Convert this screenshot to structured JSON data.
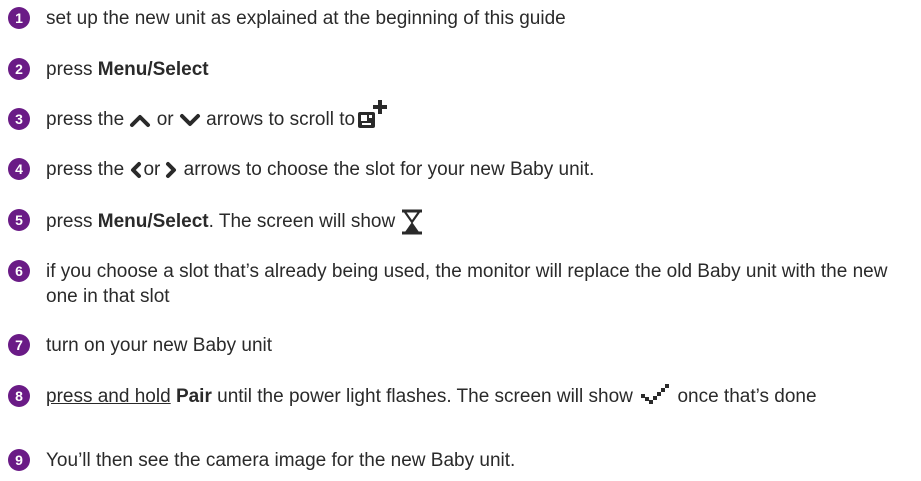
{
  "steps": [
    {
      "num": "1",
      "text": "set up the new unit as explained at the beginning of this guide"
    },
    {
      "num": "2",
      "pre": "press ",
      "bold": "Menu/Select"
    },
    {
      "num": "3",
      "pre": "press the ",
      "mid": " or ",
      "post": " arrows to scroll to",
      "icons": [
        "up-arrow-icon",
        "down-arrow-icon",
        "add-baby-unit-icon"
      ]
    },
    {
      "num": "4",
      "pre": "press the ",
      "mid": "or",
      "post": " arrows to choose the slot for your new Baby unit.",
      "icons": [
        "left-arrow-icon",
        "right-arrow-icon"
      ]
    },
    {
      "num": "5",
      "pre": "press ",
      "bold": "Menu/Select",
      "post": ". The screen will show ",
      "icons": [
        "hourglass-icon"
      ]
    },
    {
      "num": "6",
      "text": "if you choose a slot that’s already being used, the monitor will replace the old Baby unit with the new one in that slot"
    },
    {
      "num": "7",
      "text": "turn on your new Baby unit"
    },
    {
      "num": "8",
      "underlined": "press and hold",
      "space": " ",
      "bold": "Pair",
      "post": " until the power light flashes. The screen will show ",
      "post2": " once that’s done",
      "icons": [
        "paired-check-icon"
      ]
    },
    {
      "num": "9",
      "text": "You’ll then see the camera image for the new Baby unit."
    }
  ],
  "colors": {
    "badge": "#6a1b86",
    "text": "#2a2a2a"
  }
}
